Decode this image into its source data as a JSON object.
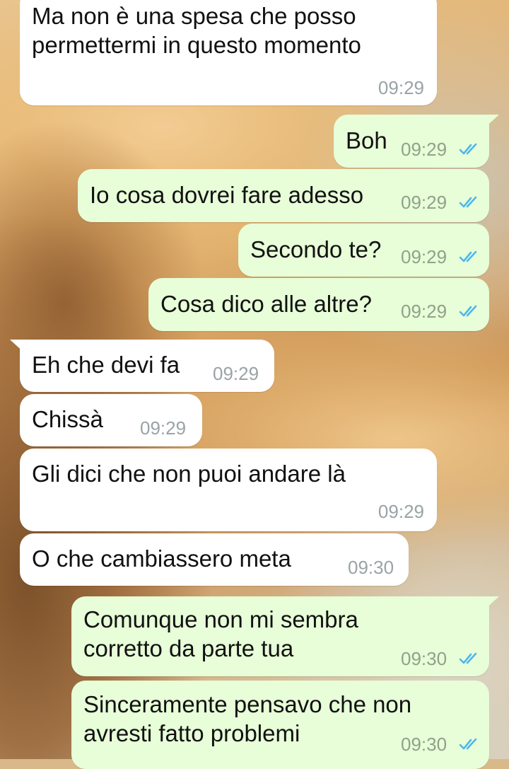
{
  "chat": {
    "messages": [
      {
        "direction": "incoming",
        "text": "Ma non è una spesa che posso\npermettermi in questo momento",
        "time": "09:29"
      },
      {
        "direction": "outgoing",
        "text": "Boh",
        "time": "09:29",
        "status": "read-double-check-icon"
      },
      {
        "direction": "outgoing",
        "text": "Io cosa dovrei fare adesso",
        "time": "09:29",
        "status": "read-double-check-icon"
      },
      {
        "direction": "outgoing",
        "text": "Secondo te?",
        "time": "09:29",
        "status": "read-double-check-icon"
      },
      {
        "direction": "outgoing",
        "text": "Cosa dico alle altre?",
        "time": "09:29",
        "status": "read-double-check-icon"
      },
      {
        "direction": "incoming",
        "text": "Eh che devi fa",
        "time": "09:29"
      },
      {
        "direction": "incoming",
        "text": "Chissà",
        "time": "09:29"
      },
      {
        "direction": "incoming",
        "text": "Gli dici che non puoi andare là",
        "time": "09:29"
      },
      {
        "direction": "incoming",
        "text": "O che cambiassero meta",
        "time": "09:30"
      },
      {
        "direction": "outgoing",
        "text": "Comunque non mi sembra\ncorretto da parte tua",
        "time": "09:30",
        "status": "read-double-check-icon"
      },
      {
        "direction": "outgoing",
        "text": "Sinceramente pensavo che non\navresti fatto problemi",
        "time": "09:30",
        "status": "read-double-check-icon"
      }
    ]
  },
  "colors": {
    "incoming_bubble": "#ffffff",
    "outgoing_bubble": "#e7fed8",
    "read_ticks": "#4fb6ec",
    "timestamp": "#9aa3a6"
  }
}
